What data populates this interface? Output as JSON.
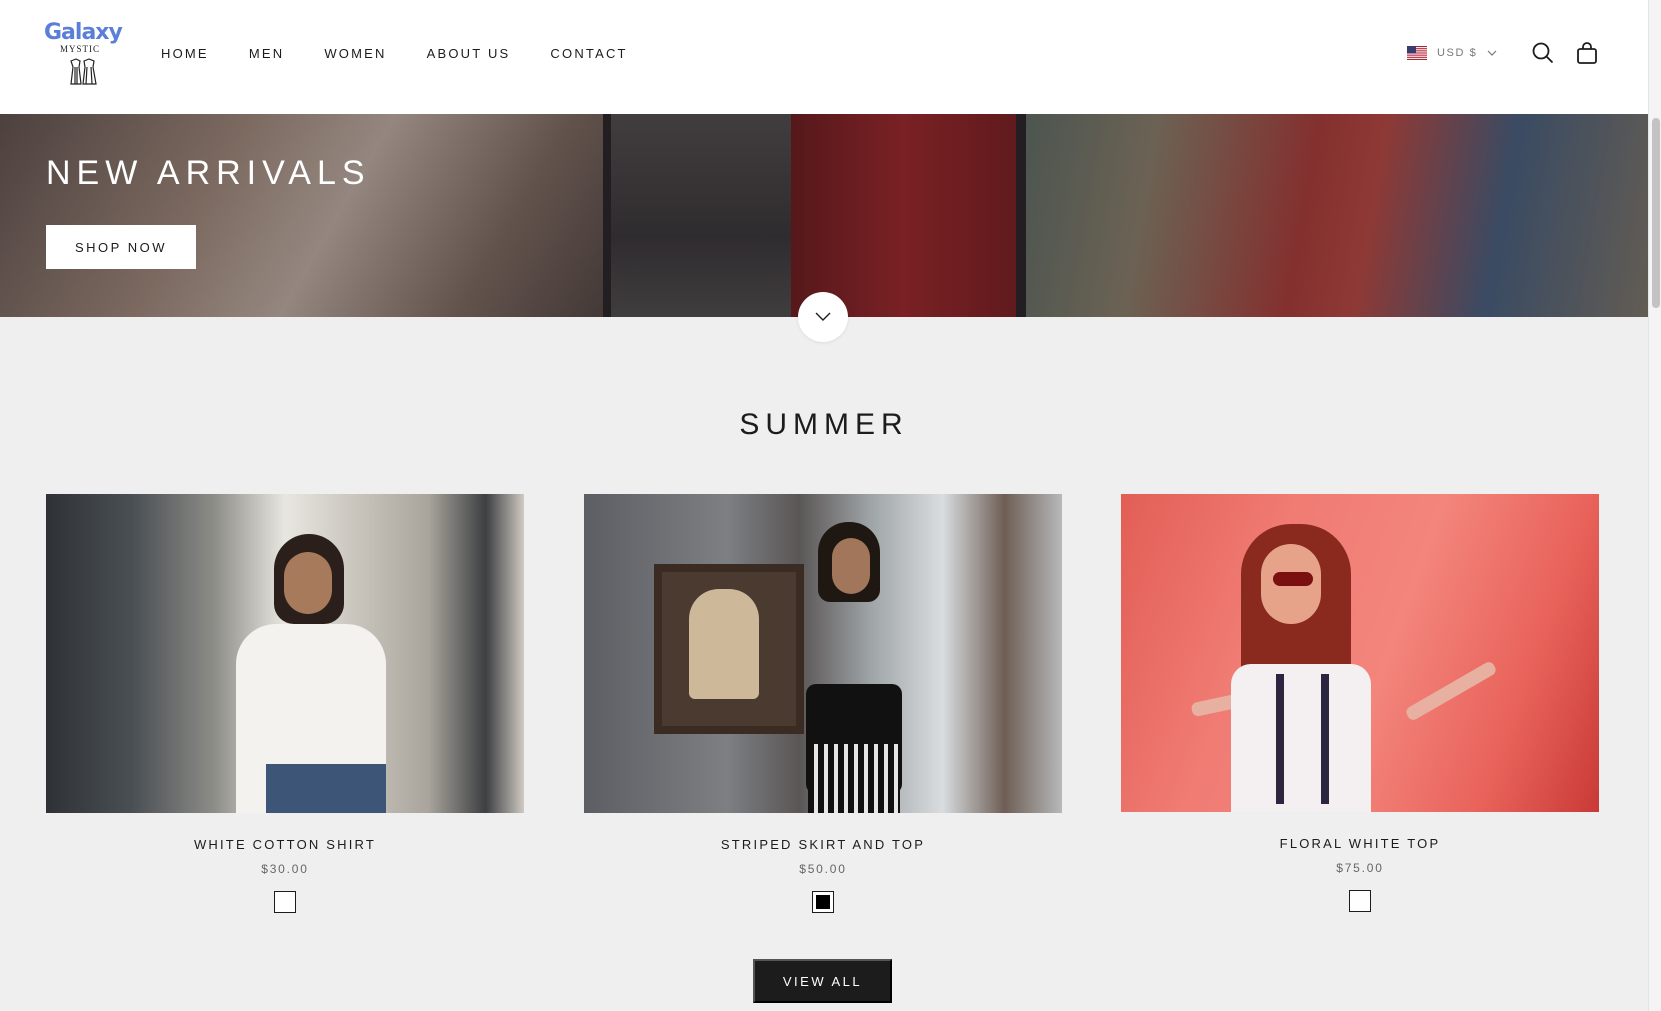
{
  "brand": {
    "name_top": "Galaxy",
    "name_bottom": "MYSTIC",
    "color": "#5b7fd8"
  },
  "nav": {
    "items": [
      {
        "label": "HOME"
      },
      {
        "label": "MEN"
      },
      {
        "label": "WOMEN"
      },
      {
        "label": "ABOUT US"
      },
      {
        "label": "CONTACT"
      }
    ]
  },
  "header": {
    "currency": "USD $",
    "flag_icon": "us-flag-icon",
    "search_icon": "search-icon",
    "cart_icon": "shopping-bag-icon"
  },
  "hero": {
    "title": "NEW ARRIVALS",
    "button_label": "SHOP NOW",
    "scroll_icon": "chevron-down-icon"
  },
  "collection": {
    "title": "SUMMER",
    "products": [
      {
        "name": "WHITE COTTON SHIRT",
        "price": "$30.00",
        "swatch_color": "#ffffff"
      },
      {
        "name": "STRIPED SKIRT AND TOP",
        "price": "$50.00",
        "swatch_color": "#000000"
      },
      {
        "name": "FLORAL WHITE TOP",
        "price": "$75.00",
        "swatch_color": "#ffffff"
      }
    ],
    "view_all_label": "VIEW ALL"
  }
}
